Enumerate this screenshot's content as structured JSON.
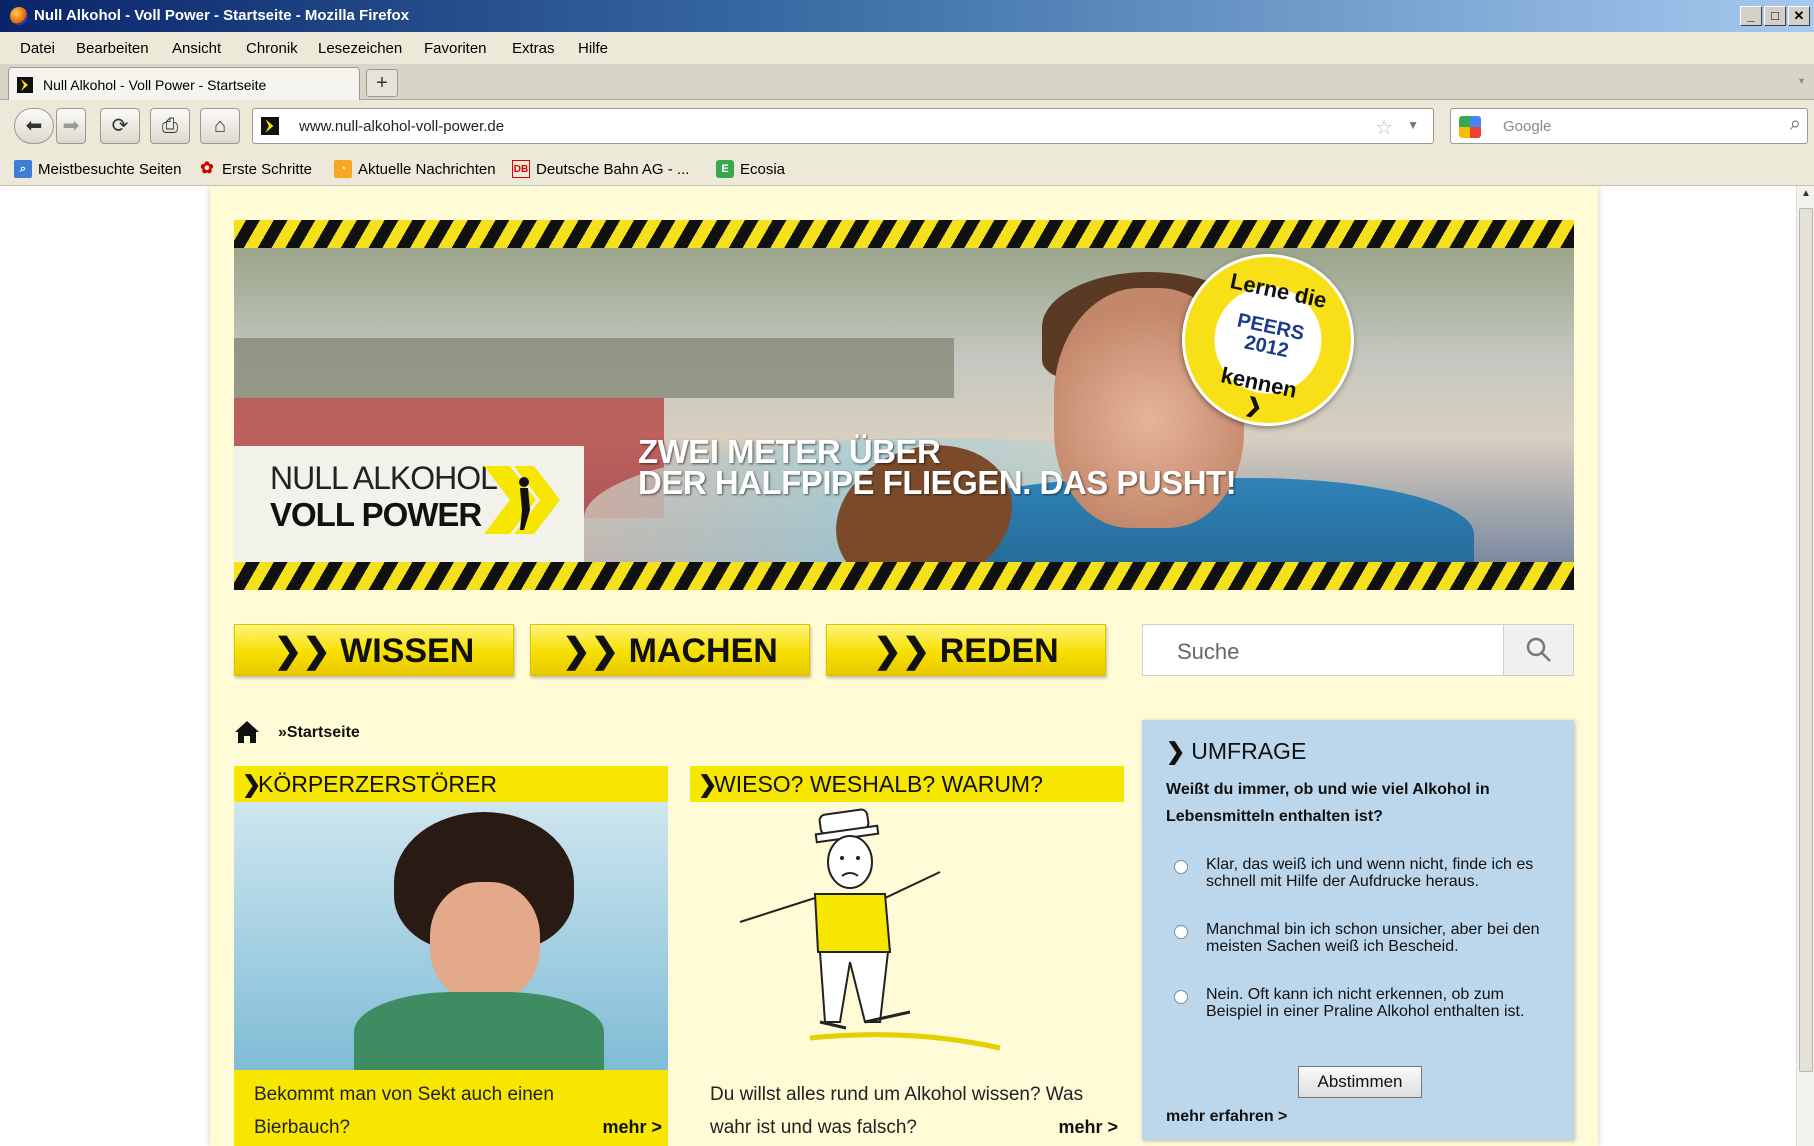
{
  "window": {
    "title": "Null Alkohol - Voll Power -  Startseite - Mozilla Firefox",
    "controls": [
      "_",
      "□",
      "✕"
    ]
  },
  "menu": [
    "Datei",
    "Bearbeiten",
    "Ansicht",
    "Chronik",
    "Lesezeichen",
    "Favoriten",
    "Extras",
    "Hilfe"
  ],
  "tab": {
    "label": "Null Alkohol - Voll Power -  Startseite",
    "new_tab": "+"
  },
  "address": {
    "url": "www.null-alkohol-voll-power.de"
  },
  "browser_search": {
    "placeholder": "Google"
  },
  "bookmarks": [
    {
      "label": "Meistbesuchte Seiten",
      "icon": "search-icon"
    },
    {
      "label": "Erste Schritte",
      "icon": "firefox-icon"
    },
    {
      "label": "Aktuelle Nachrichten",
      "icon": "rss-icon"
    },
    {
      "label": "Deutsche Bahn AG - ...",
      "icon": "db-icon"
    },
    {
      "label": "Ecosia",
      "icon": "ecosia-icon"
    }
  ],
  "banner": {
    "logo_line1": "NULL ALKOHOL",
    "logo_line2": "VOLL POWER",
    "headline_line1": "ZWEI METER ÜBER",
    "headline_line2": "DER HALFPIPE FLIEGEN. DAS PUSHT!",
    "badge_line1": "Lerne die",
    "badge_line2": "PEERS",
    "badge_line3": "2012",
    "badge_line4": "kennen",
    "badge_arrow": "❯"
  },
  "nav": {
    "wissen": "WISSEN",
    "machen": "MACHEN",
    "reden": "REDEN",
    "prefix": "❯❯"
  },
  "site_search": {
    "placeholder": "Suche"
  },
  "breadcrumb": {
    "current": "»Startseite"
  },
  "teasers": [
    {
      "title": "KÖRPERZERSTÖRER",
      "text": "Bekommt man von Sekt auch einen Bierbauch?",
      "more": "mehr >"
    },
    {
      "title": "WIESO? WESHALB? WARUM?",
      "text": "Du willst alles rund um Alkohol wissen? Was wahr ist und was falsch?",
      "more": "mehr >"
    }
  ],
  "poll": {
    "title": "UMFRAGE",
    "question": "Weißt du immer, ob und wie viel Alkohol in Lebensmitteln enthalten ist?",
    "options": [
      "Klar, das weiß ich und wenn nicht, finde ich es schnell mit Hilfe der Aufdrucke heraus.",
      "Manchmal bin ich schon unsicher, aber bei den meisten Sachen weiß ich Bescheid.",
      "Nein. Oft kann ich nicht erkennen, ob zum Beispiel in einer Praline Alkohol enthalten ist."
    ],
    "submit": "Abstimmen",
    "more": "mehr erfahren >"
  },
  "colors": {
    "brand_yellow": "#f7e600",
    "poll_blue": "#bcd7ec",
    "page_bg": "#fffbd6"
  }
}
